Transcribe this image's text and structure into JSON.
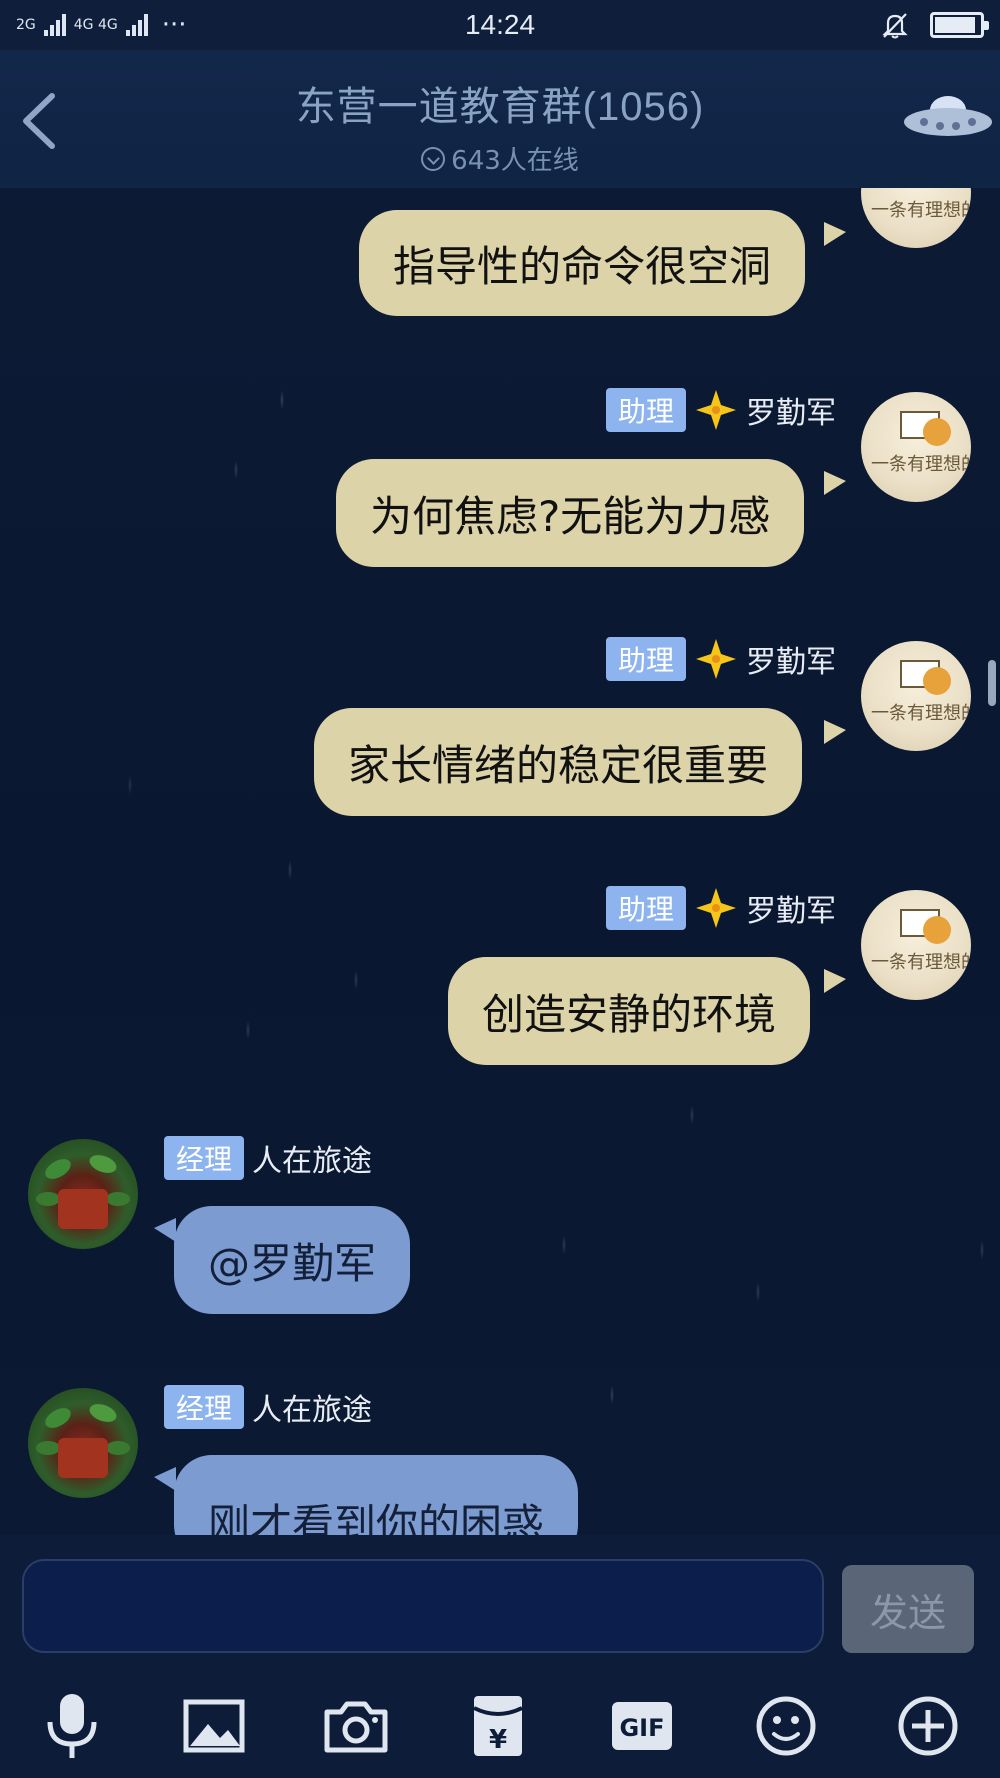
{
  "status_bar": {
    "network_left": "2G",
    "network_right": "4G 4G",
    "more": "···",
    "time": "14:24",
    "battery_level": 0.92
  },
  "header": {
    "title": "东营一道教育群(1056)",
    "online": "643人在线",
    "back_icon": "chevron-left-icon",
    "right_icon": "ufo-icon"
  },
  "messages": [
    {
      "side": "right",
      "text": "指导性的命令很空洞"
    },
    {
      "side": "right",
      "badge": "助理",
      "sender": "罗勤军",
      "text": "为何焦虑?无能为力感"
    },
    {
      "side": "right",
      "badge": "助理",
      "sender": "罗勤军",
      "text": "家长情绪的稳定很重要"
    },
    {
      "side": "right",
      "badge": "助理",
      "sender": "罗勤军",
      "text": "创造安静的环境"
    },
    {
      "side": "left",
      "badge": "经理",
      "sender": "人在旅途",
      "text": "@罗勤军"
    },
    {
      "side": "left",
      "badge": "经理",
      "sender": "人在旅途",
      "text": "刚才看到你的困惑"
    }
  ],
  "input": {
    "value": "",
    "send_label": "发送"
  },
  "toolbar": {
    "items": [
      "microphone-icon",
      "image-icon",
      "camera-icon",
      "red-packet-icon",
      "gif-icon",
      "emoji-icon",
      "plus-icon"
    ],
    "gif_label": "GIF",
    "yuan": "¥"
  },
  "colors": {
    "background": "#0c1a33",
    "bubble_right": "#dcd3a9",
    "bubble_left": "#7c9bd0",
    "badge": "#8db4ef",
    "star": "#f5c518"
  }
}
